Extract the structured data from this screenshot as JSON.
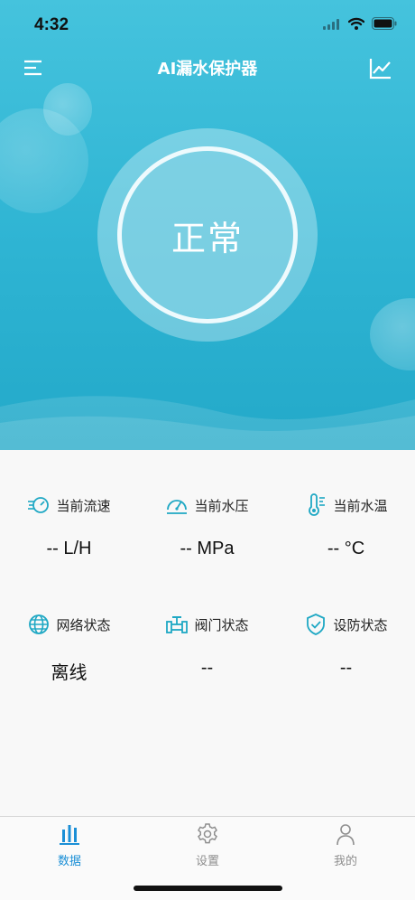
{
  "status_bar": {
    "time": "4:32"
  },
  "nav": {
    "title": "AI漏水保护器"
  },
  "hero": {
    "status": "正常"
  },
  "metrics": [
    {
      "icon": "flow-speed-icon",
      "label": "当前流速",
      "value": "-- L/H"
    },
    {
      "icon": "gauge-icon",
      "label": "当前水压",
      "value": "-- MPa"
    },
    {
      "icon": "thermometer-icon",
      "label": "当前水温",
      "value": "-- °C"
    },
    {
      "icon": "globe-icon",
      "label": "网络状态",
      "value": "离线"
    },
    {
      "icon": "valve-icon",
      "label": "阀门状态",
      "value": "--"
    },
    {
      "icon": "shield-check-icon",
      "label": "设防状态",
      "value": "--"
    }
  ],
  "tabs": [
    {
      "icon": "bar-chart-icon",
      "label": "数据",
      "active": true
    },
    {
      "icon": "gear-icon",
      "label": "设置",
      "active": false
    },
    {
      "icon": "person-icon",
      "label": "我的",
      "active": false
    }
  ],
  "colors": {
    "accent": "#1fa8c4",
    "tab_active": "#1b8fd6",
    "tab_inactive": "#8e8e8e",
    "hero_top": "#45c3dd",
    "hero_bottom": "#23a9c9"
  }
}
